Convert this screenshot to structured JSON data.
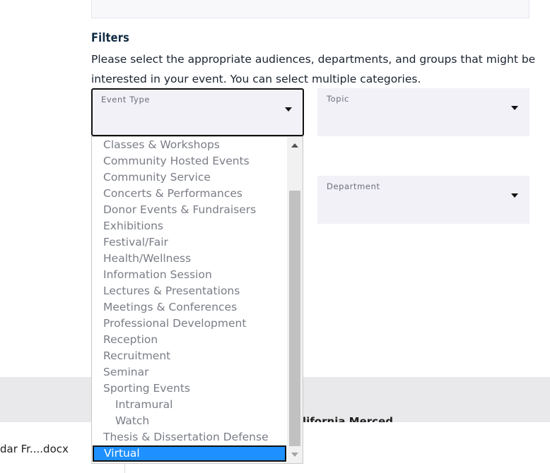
{
  "filters": {
    "title": "Filters",
    "description": "Please select the appropriate audiences, departments, and groups that might be interested in your event. You can select multiple categories."
  },
  "event_type": {
    "label": "Event Type",
    "value": ""
  },
  "topic": {
    "label": "Topic",
    "value": ""
  },
  "department": {
    "label": "Department",
    "value": ""
  },
  "dropdown": {
    "options": [
      {
        "label": "Classes & Workshops"
      },
      {
        "label": "Community Hosted Events"
      },
      {
        "label": "Community Service"
      },
      {
        "label": "Concerts & Performances"
      },
      {
        "label": "Donor Events & Fundraisers"
      },
      {
        "label": "Exhibitions"
      },
      {
        "label": "Festival/Fair"
      },
      {
        "label": "Health/Wellness"
      },
      {
        "label": "Information Session"
      },
      {
        "label": "Lectures & Presentations"
      },
      {
        "label": "Meetings & Conferences"
      },
      {
        "label": "Professional Development"
      },
      {
        "label": "Reception"
      },
      {
        "label": "Recruitment"
      },
      {
        "label": "Seminar"
      },
      {
        "label": "Sporting Events"
      },
      {
        "label": "Intramural"
      },
      {
        "label": "Watch"
      },
      {
        "label": "Thesis & Dissertation Defense"
      },
      {
        "label": "Virtual"
      }
    ],
    "selected": "Virtual",
    "highlight_color": "#1e90ff"
  },
  "background": {
    "band_text": "lifornia Merced",
    "file_name": "dar Fr....docx"
  }
}
